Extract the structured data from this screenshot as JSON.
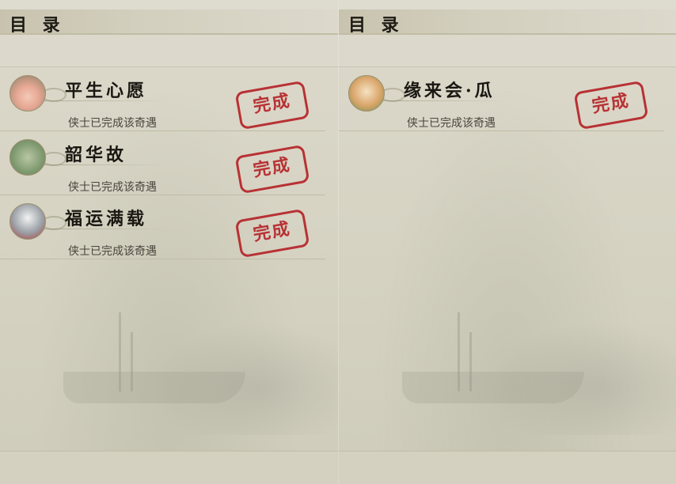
{
  "colors": {
    "stamp": "#b52025",
    "paper": "#d9d6c8",
    "ink": "#1a1712"
  },
  "left_panel": {
    "title": "目 录",
    "entries": [
      {
        "name": "平生心愿",
        "status": "侠士已完成该奇遇",
        "stamp": "完成",
        "icon": "official-avatar-icon"
      },
      {
        "name": "韶华故",
        "status": "侠士已完成该奇遇",
        "stamp": "完成",
        "icon": "green-robe-avatar-icon"
      },
      {
        "name": "福运满载",
        "status": "侠士已完成该奇遇",
        "stamp": "完成",
        "icon": "husky-dog-avatar-icon"
      }
    ]
  },
  "right_panel": {
    "title": "目 录",
    "entries": [
      {
        "name": "缘来会·瓜",
        "status": "侠士已完成该奇遇",
        "stamp": "完成",
        "icon": "cat-avatar-icon"
      }
    ]
  }
}
